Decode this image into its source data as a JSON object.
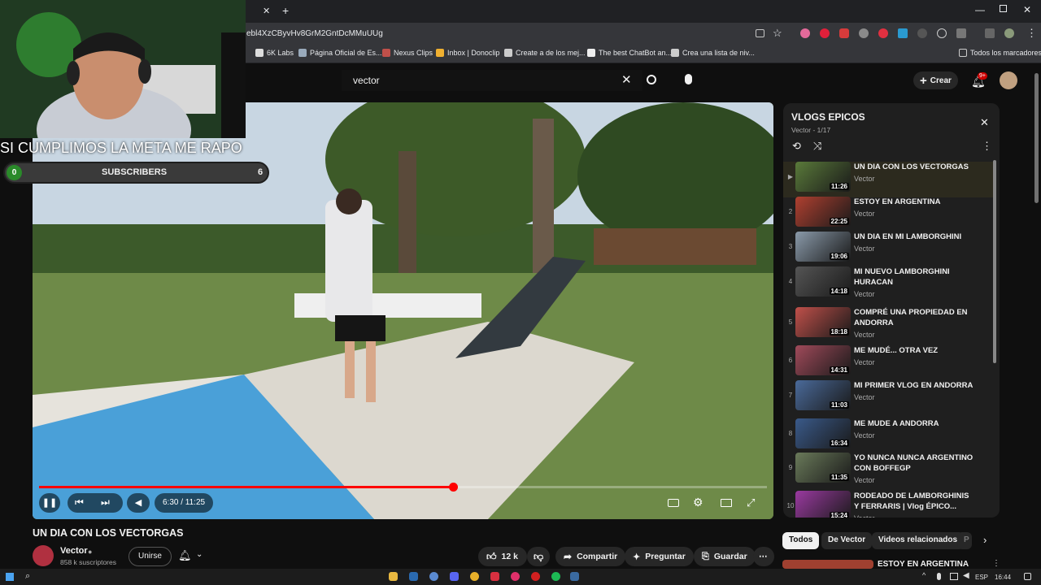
{
  "browser": {
    "url_fragment": "ebl4XzCByvHv8GrM2GntDcMMuUUg",
    "bookmarks": [
      "6K Labs",
      "Página Oficial de Es...",
      "Nexus Clips",
      "Inbox | Donoclip",
      "Create a de los mej...",
      "The best ChatBot an...",
      "Crea una lista de niv..."
    ],
    "bookmarks_folder": "Todos los marcadores"
  },
  "header": {
    "search_value": "vector",
    "create_label": "Crear",
    "notif_badge": "9+"
  },
  "overlay": {
    "goal_text": "SI CUMPLIMOS LA META ME RAPO",
    "goal_current": "0",
    "goal_label": "SUBSCRIBERS",
    "goal_target": "6"
  },
  "player": {
    "time": "6:30 / 11:25",
    "progress": 0.569
  },
  "video": {
    "title": "UN DIA CON LOS VECTORGAS",
    "channel": "Vector",
    "subscribers": "858 k suscriptores",
    "join_label": "Unirse",
    "likes": "12 k",
    "share_label": "Compartir",
    "ask_label": "Preguntar",
    "save_label": "Guardar"
  },
  "playlist": {
    "title": "VLOGS EPICOS",
    "meta": "Vector - 1/17",
    "items": [
      {
        "num": "▶",
        "title": "UN DIA CON LOS VECTORGAS",
        "channel": "Vector",
        "duration": "11:26",
        "color": "#5a7a3a"
      },
      {
        "num": "2",
        "title": "ESTOY EN ARGENTINA",
        "channel": "Vector",
        "duration": "22:25",
        "color": "#b04030"
      },
      {
        "num": "3",
        "title": "UN DIA EN MI LAMBORGHINI",
        "channel": "Vector",
        "duration": "19:06",
        "color": "#8a9aaa"
      },
      {
        "num": "4",
        "title": "MI NUEVO LAMBORGHINI HURACAN",
        "channel": "Vector",
        "duration": "14:18",
        "color": "#555"
      },
      {
        "num": "5",
        "title": "COMPRÉ UNA PROPIEDAD EN ANDORRA",
        "channel": "Vector",
        "duration": "18:18",
        "color": "#c0504a"
      },
      {
        "num": "6",
        "title": "ME MUDÉ... OTRA VEZ",
        "channel": "Vector",
        "duration": "14:31",
        "color": "#a04a5a"
      },
      {
        "num": "7",
        "title": "MI PRIMER VLOG EN ANDORRA",
        "channel": "Vector",
        "duration": "11:03",
        "color": "#4a6a9a"
      },
      {
        "num": "8",
        "title": "ME MUDE A ANDORRA",
        "channel": "Vector",
        "duration": "16:34",
        "color": "#3a5a8a"
      },
      {
        "num": "9",
        "title": "YO NUNCA NUNCA ARGENTINO CON BOFFEGP",
        "channel": "Vector",
        "duration": "11:35",
        "color": "#6a7a5a"
      },
      {
        "num": "10",
        "title": "RODEADO DE LAMBORGHINIS Y FERRARIS | Vlog ÉPICO...",
        "channel": "Vector",
        "duration": "15:24",
        "color": "#9a3aa0"
      }
    ]
  },
  "chips": [
    "Todos",
    "De Vector",
    "Videos relacionados",
    "P"
  ],
  "related": {
    "title": "ESTOY EN ARGENTINA"
  },
  "taskbar": {
    "lang": "ESP",
    "time": "16:44"
  }
}
